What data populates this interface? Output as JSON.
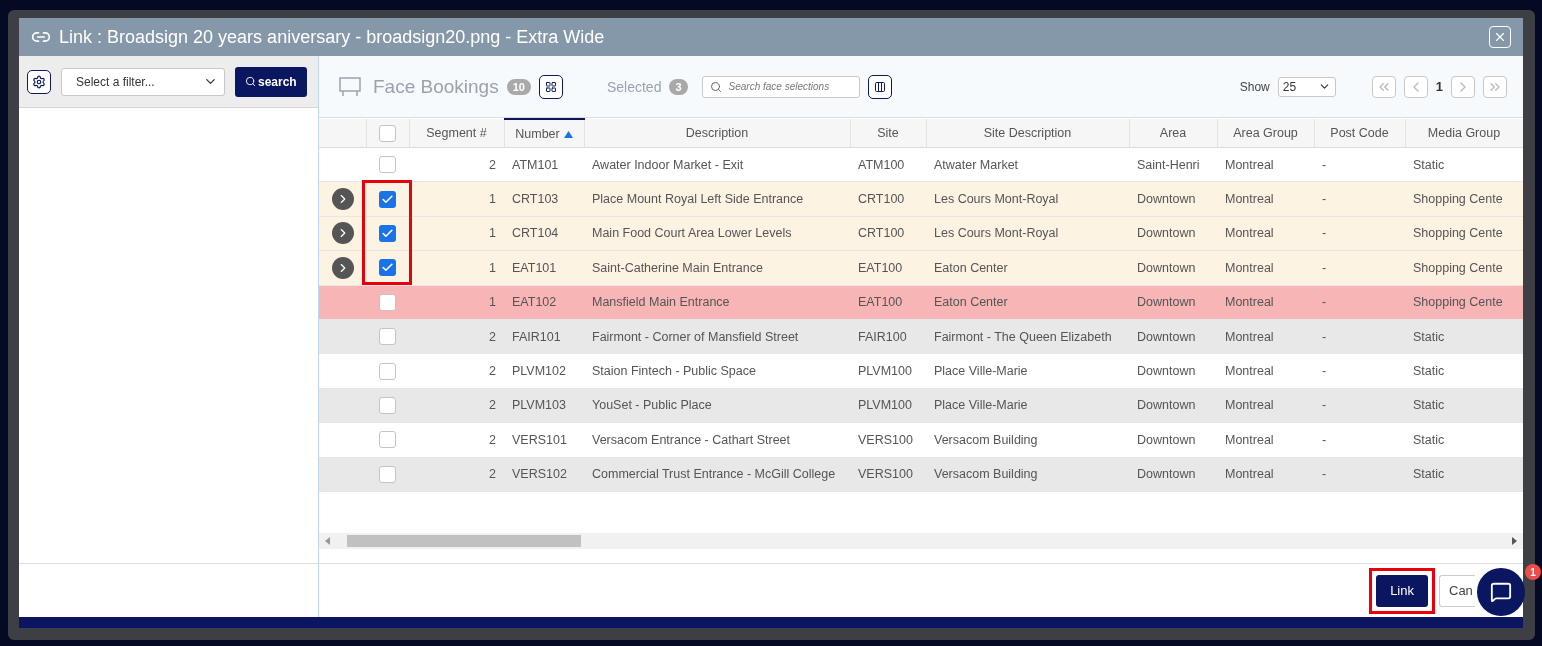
{
  "window": {
    "title": "Link : Broadsign 20 years aniversary - broadsign20.png - Extra Wide"
  },
  "filter_panel": {
    "filter_select": {
      "placeholder": "Select a filter..."
    },
    "search_button": "search"
  },
  "toolbar": {
    "title": "Face Bookings",
    "count": "10",
    "selected_label": "Selected",
    "selected_count": "3",
    "search": {
      "placeholder": "Search face selections"
    },
    "show_label": "Show",
    "page_size": "25",
    "page": "1"
  },
  "table": {
    "all_checked": false,
    "columns": [
      {
        "label": "Segment #",
        "sorted": false
      },
      {
        "label": "Number",
        "sorted": true
      },
      {
        "label": "Description",
        "sorted": false
      },
      {
        "label": "Site",
        "sorted": false
      },
      {
        "label": "Site Description",
        "sorted": false
      },
      {
        "label": "Area",
        "sorted": false
      },
      {
        "label": "Area Group",
        "sorted": false
      },
      {
        "label": "Post Code",
        "sorted": false
      },
      {
        "label": "Media Group",
        "sorted": false
      }
    ],
    "rows": [
      {
        "checked": false,
        "expandable": false,
        "conflict": false,
        "marked": false,
        "cells": [
          "2",
          "ATM101",
          "Awater Indoor Market - Exit",
          "ATM100",
          "Atwater Market",
          "Saint-Henri",
          "Montreal",
          "-",
          "Static"
        ]
      },
      {
        "checked": true,
        "expandable": true,
        "conflict": false,
        "marked": true,
        "cells": [
          "1",
          "CRT103",
          "Place Mount Royal Left Side Entrance",
          "CRT100",
          "Les Cours Mont-Royal",
          "Downtown",
          "Montreal",
          "-",
          "Shopping Cente"
        ]
      },
      {
        "checked": true,
        "expandable": true,
        "conflict": false,
        "marked": true,
        "cells": [
          "1",
          "CRT104",
          "Main Food Court Area Lower Levels",
          "CRT100",
          "Les Cours Mont-Royal",
          "Downtown",
          "Montreal",
          "-",
          "Shopping Cente"
        ]
      },
      {
        "checked": true,
        "expandable": true,
        "conflict": false,
        "marked": true,
        "cells": [
          "1",
          "EAT101",
          "Saint-Catherine Main Entrance",
          "EAT100",
          "Eaton Center",
          "Downtown",
          "Montreal",
          "-",
          "Shopping Cente"
        ]
      },
      {
        "checked": false,
        "expandable": false,
        "conflict": true,
        "marked": false,
        "cells": [
          "1",
          "EAT102",
          "Mansfield Main Entrance",
          "EAT100",
          "Eaton Center",
          "Downtown",
          "Montreal",
          "-",
          "Shopping Cente"
        ]
      },
      {
        "checked": false,
        "expandable": false,
        "conflict": false,
        "marked": false,
        "cells": [
          "2",
          "FAIR101",
          "Fairmont - Corner of Mansfield Street",
          "FAIR100",
          "Fairmont - The Queen Elizabeth",
          "Downtown",
          "Montreal",
          "-",
          "Static"
        ]
      },
      {
        "checked": false,
        "expandable": false,
        "conflict": false,
        "marked": false,
        "cells": [
          "2",
          "PLVM102",
          "Staion Fintech - Public Space",
          "PLVM100",
          "Place Ville-Marie",
          "Downtown",
          "Montreal",
          "-",
          "Static"
        ]
      },
      {
        "checked": false,
        "expandable": false,
        "conflict": false,
        "marked": false,
        "cells": [
          "2",
          "PLVM103",
          "YouSet - Public Place",
          "PLVM100",
          "Place Ville-Marie",
          "Downtown",
          "Montreal",
          "-",
          "Static"
        ]
      },
      {
        "checked": false,
        "expandable": false,
        "conflict": false,
        "marked": false,
        "cells": [
          "2",
          "VERS101",
          "Versacom Entrance - Cathart Street",
          "VERS100",
          "Versacom Building",
          "Downtown",
          "Montreal",
          "-",
          "Static"
        ]
      },
      {
        "checked": false,
        "expandable": false,
        "conflict": false,
        "marked": false,
        "cells": [
          "2",
          "VERS102",
          "Commercial Trust Entrance - McGill College",
          "VERS100",
          "Versacom Building",
          "Downtown",
          "Montreal",
          "-",
          "Static"
        ]
      }
    ]
  },
  "footer": {
    "buttons": [
      {
        "label": "Link",
        "kind": "primary",
        "marked": true
      },
      {
        "label": "Can",
        "kind": "secondary"
      }
    ]
  },
  "chat": {
    "badge": "1"
  }
}
